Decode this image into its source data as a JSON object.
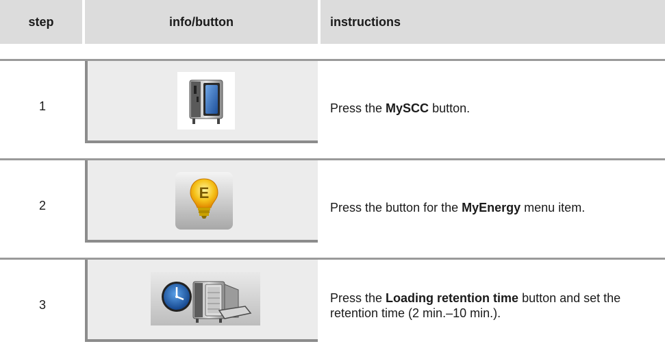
{
  "header": {
    "step": "step",
    "info": "info/button",
    "instructions": "instructions"
  },
  "rows": [
    {
      "step": "1",
      "icon": "oven-icon",
      "pre": "Press the ",
      "bold": "MySCC",
      "post": " button."
    },
    {
      "step": "2",
      "icon": "energy-bulb-icon",
      "pre": "Press the button for the ",
      "bold": "MyEnergy",
      "post": " menu item."
    },
    {
      "step": "3",
      "icon": "loading-retention-time-icon",
      "pre": "Press the ",
      "bold": "Loading retention time",
      "post": " button and set the retention time (2 min.–10 min.)."
    }
  ]
}
